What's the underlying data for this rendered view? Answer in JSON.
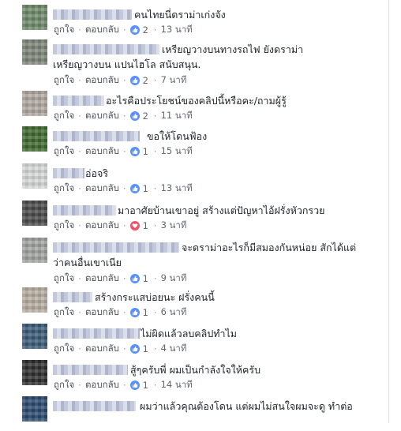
{
  "labels": {
    "like": "ถูกใจ",
    "reply": "ตอบกลับ",
    "sep": "·"
  },
  "comments": [
    {
      "text": "คนไทยนี่ดราม่าเก่งจัง",
      "reaction": "like-icon",
      "count": "2",
      "time": "13 นาที"
    },
    {
      "text": "เหรียญวางบนทางรถไฟ ยังดราม่า",
      "text2": "เหรียญวางบน แปนไฮโล สนับสนุน.",
      "reaction": "like-icon",
      "count": "2",
      "time": "7 นาที"
    },
    {
      "text": "อะไรคือประโยชน์ของคลิปนี้หรือคะ/ถามผู้รู้",
      "reaction": "like-icon",
      "count": "2",
      "time": "11 นาที"
    },
    {
      "text": "ขอให้โดนฟ้อง",
      "reaction": "like-icon",
      "count": "1",
      "time": "15 นาที"
    },
    {
      "text": "อ่อจริ",
      "reaction": "like-icon",
      "count": "1",
      "time": "13 นาที"
    },
    {
      "text": "มาอาศัยบ้านเขาอยู่ สร้างแต่ปัญหาไอ้ฝรั่งหัวกรวย",
      "reaction": "love-icon",
      "count": "1",
      "time": "3 นาที"
    },
    {
      "text": "จะดราม่าอะไรก็มีสมองกันหน่อย สักได้แต่",
      "text2": "ว่าคนอื่นเขาเนีย",
      "reaction": "like-icon",
      "count": "1",
      "time": "9 นาที"
    },
    {
      "text": "สร้างกระแสบ่อยนะ ฝรั่งคนนี้",
      "reaction": "like-icon",
      "count": "1",
      "time": "6 นาที"
    },
    {
      "text": "ไม่ผิดแล้วลบคลิปทำไม",
      "reaction": "like-icon",
      "count": "1",
      "time": "4 นาที"
    },
    {
      "text": "สู้ๆครับพี่ ผมเป็นกำลังใจให้ครับ",
      "reaction": "like-icon",
      "count": "1",
      "time": "14 นาที"
    },
    {
      "text": "ผมว่าแล้วคุณต้องโดน แต่ผมไม่สนใจผมจะดู ทำต่อ"
    }
  ]
}
